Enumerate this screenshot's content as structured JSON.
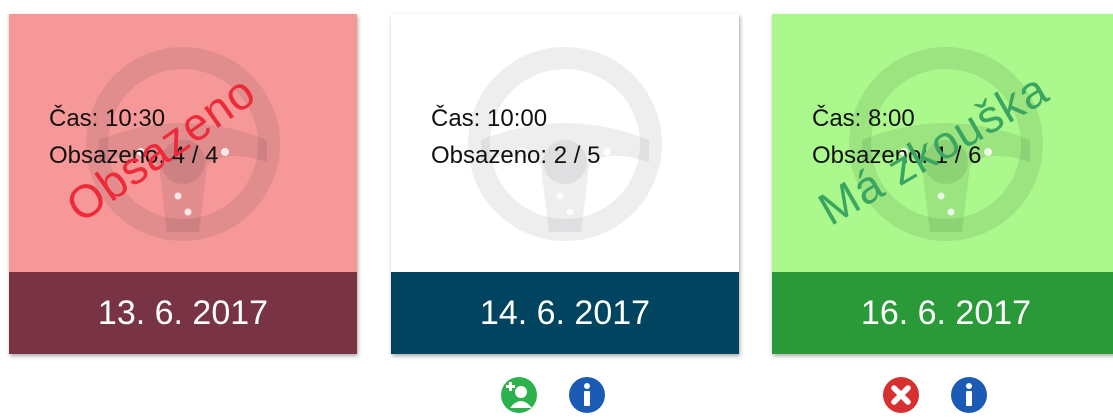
{
  "colors": {
    "full_body": "#f79898",
    "full_bar": "#783344",
    "full_stamp": "#ee2a39",
    "open_body": "#ffffff",
    "open_bar": "#00445f",
    "exam_body": "#abf88d",
    "exam_bar": "#2a9a39",
    "exam_stamp": "#3aa561"
  },
  "cards": [
    {
      "time": "Čas: 10:30",
      "occupancy": "Obsazeno: 4 / 4",
      "date": "13. 6. 2017",
      "stamp": "Obsazeno"
    },
    {
      "time": "Čas: 10:00",
      "occupancy": "Obsazeno: 2 / 5",
      "date": "14. 6. 2017"
    },
    {
      "time": "Čas: 8:00",
      "occupancy": "Obsazeno: 1 / 6",
      "date": "16. 6. 2017",
      "stamp": "Má zkouška"
    }
  ],
  "icons": {
    "watermark": "steering-wheel-icon",
    "signup": "add-user-icon",
    "info": "info-icon",
    "cancel": "cancel-icon"
  }
}
